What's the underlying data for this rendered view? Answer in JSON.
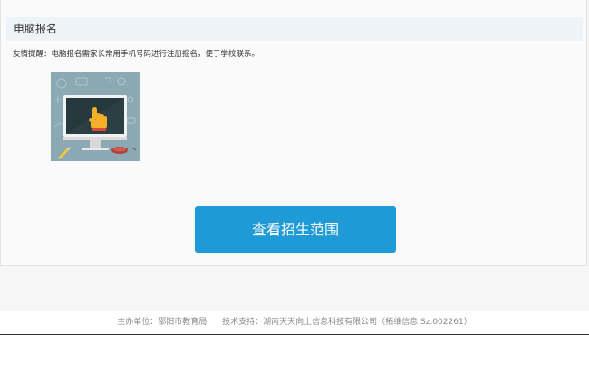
{
  "section": {
    "title": "电脑报名",
    "tip": "友情提醒：电脑报名需家长常用手机号码进行注册报名，便于学校联系。"
  },
  "illustration": {
    "icon": "computer-hand-pointer-icon",
    "colors": {
      "background": "#8aa9b3",
      "screen": "#25383b",
      "hand": "#f5b02a"
    }
  },
  "cta": {
    "label": "查看招生范围",
    "color": "#1e9ad6"
  },
  "footer": {
    "host": "主办单位：邵阳市教育局",
    "support": "技术支持：湖南天天向上信息科技有限公司（拓维信息 Sz.002261）"
  }
}
